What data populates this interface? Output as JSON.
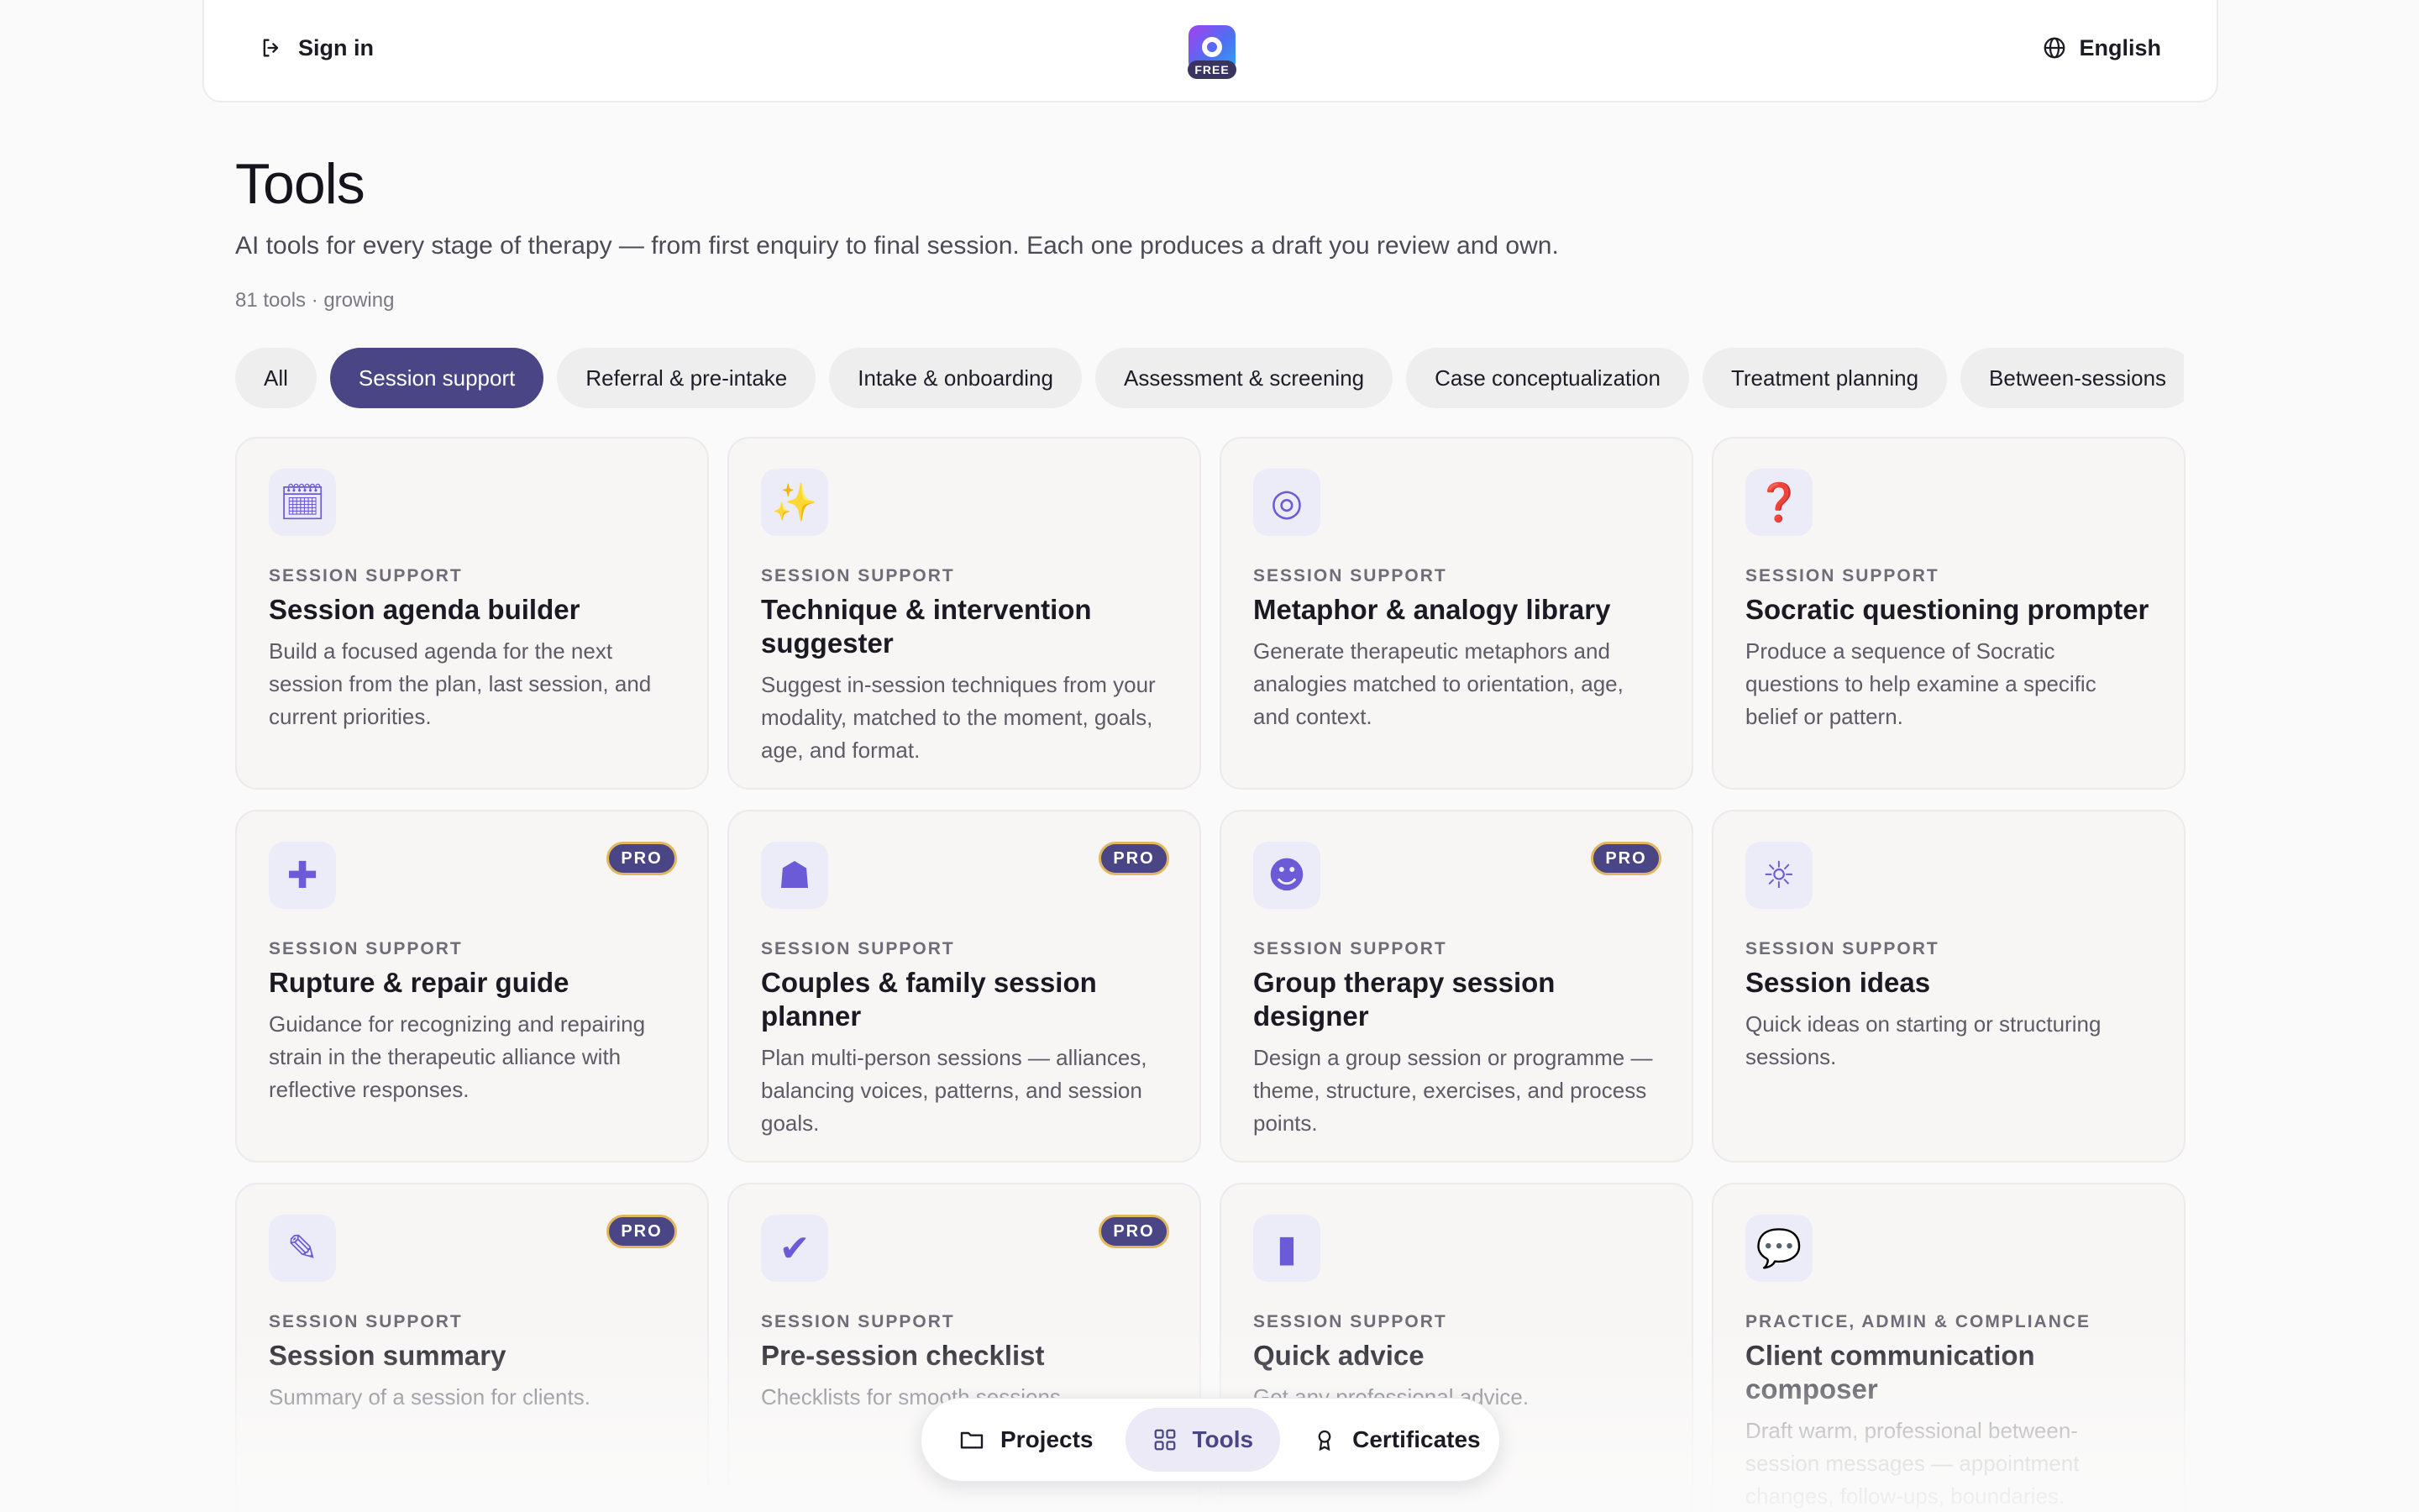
{
  "header": {
    "sign_in": "Sign in",
    "logo_badge": "FREE",
    "language": "English"
  },
  "page": {
    "title": "Tools",
    "subtitle": "AI tools for every stage of therapy — from first enquiry to final session. Each one produces a draft you review and own.",
    "count": "81 tools · growing"
  },
  "filters": [
    {
      "label": "All",
      "active": false
    },
    {
      "label": "Session support",
      "active": true
    },
    {
      "label": "Referral & pre-intake",
      "active": false
    },
    {
      "label": "Intake & onboarding",
      "active": false
    },
    {
      "label": "Assessment & screening",
      "active": false
    },
    {
      "label": "Case conceptualization",
      "active": false
    },
    {
      "label": "Treatment planning",
      "active": false
    },
    {
      "label": "Between-sessions",
      "active": false
    }
  ],
  "pro_label": "PRO",
  "cards": [
    {
      "icon": "calendar-icon",
      "glyph": "🗓",
      "category": "Session support",
      "name": "Session agenda builder",
      "desc": "Build a focused agenda for the next session from the plan, last session, and current priorities.",
      "pro": false
    },
    {
      "icon": "magic-wand-icon",
      "glyph": "✨",
      "category": "Session support",
      "name": "Technique & intervention suggester",
      "desc": "Suggest in-session techniques from your modality, matched to the moment, goals, age, and format.",
      "pro": false
    },
    {
      "icon": "mirror-icon",
      "glyph": "◎",
      "category": "Session support",
      "name": "Metaphor & analogy library",
      "desc": "Generate therapeutic metaphors and analogies matched to orientation, age, and context.",
      "pro": false
    },
    {
      "icon": "question-mark-icon",
      "glyph": "❓",
      "category": "Session support",
      "name": "Socratic questioning prompter",
      "desc": "Produce a sequence of Socratic questions to help examine a specific belief or pattern.",
      "pro": false
    },
    {
      "icon": "bandage-icon",
      "glyph": "✚",
      "category": "Session support",
      "name": "Rupture & repair guide",
      "desc": "Guidance for recognizing and repairing strain in the therapeutic alliance with reflective responses.",
      "pro": true
    },
    {
      "icon": "family-icon",
      "glyph": "☗",
      "category": "Session support",
      "name": "Couples & family session planner",
      "desc": "Plan multi-person sessions — alliances, balancing voices, patterns, and session goals.",
      "pro": true
    },
    {
      "icon": "group-icon",
      "glyph": "☻",
      "category": "Session support",
      "name": "Group therapy session designer",
      "desc": "Design a group session or programme — theme, structure, exercises, and process points.",
      "pro": true
    },
    {
      "icon": "lightbulb-icon",
      "glyph": "☼",
      "category": "Session support",
      "name": "Session ideas",
      "desc": "Quick ideas on starting or structuring sessions.",
      "pro": false
    },
    {
      "icon": "memo-icon",
      "glyph": "✎",
      "category": "Session support",
      "name": "Session summary",
      "desc": "Summary of a session for clients.",
      "pro": true
    },
    {
      "icon": "checkmark-icon",
      "glyph": "✔",
      "category": "Session support",
      "name": "Pre-session checklist",
      "desc": "Checklists for smooth sessions.",
      "pro": true
    },
    {
      "icon": "book-icon",
      "glyph": "▮",
      "category": "Session support",
      "name": "Quick advice",
      "desc": "Get any professional advice.",
      "pro": false
    },
    {
      "icon": "speech-bubble-icon",
      "glyph": "💬",
      "category": "Practice, admin & compliance",
      "name": "Client communication composer",
      "desc": "Draft warm, professional between-session messages — appointment changes, follow-ups, boundaries.",
      "pro": false
    }
  ],
  "bottom_nav": [
    {
      "label": "Projects",
      "icon": "folder-icon",
      "active": false
    },
    {
      "label": "Tools",
      "icon": "grid-icon",
      "active": true
    },
    {
      "label": "Certificates",
      "icon": "award-icon",
      "active": false
    }
  ],
  "colors": {
    "accent": "#4a4585",
    "pro_border": "#e3b760",
    "card_bg": "#f7f6f5",
    "page_bg": "#fbfafa"
  }
}
